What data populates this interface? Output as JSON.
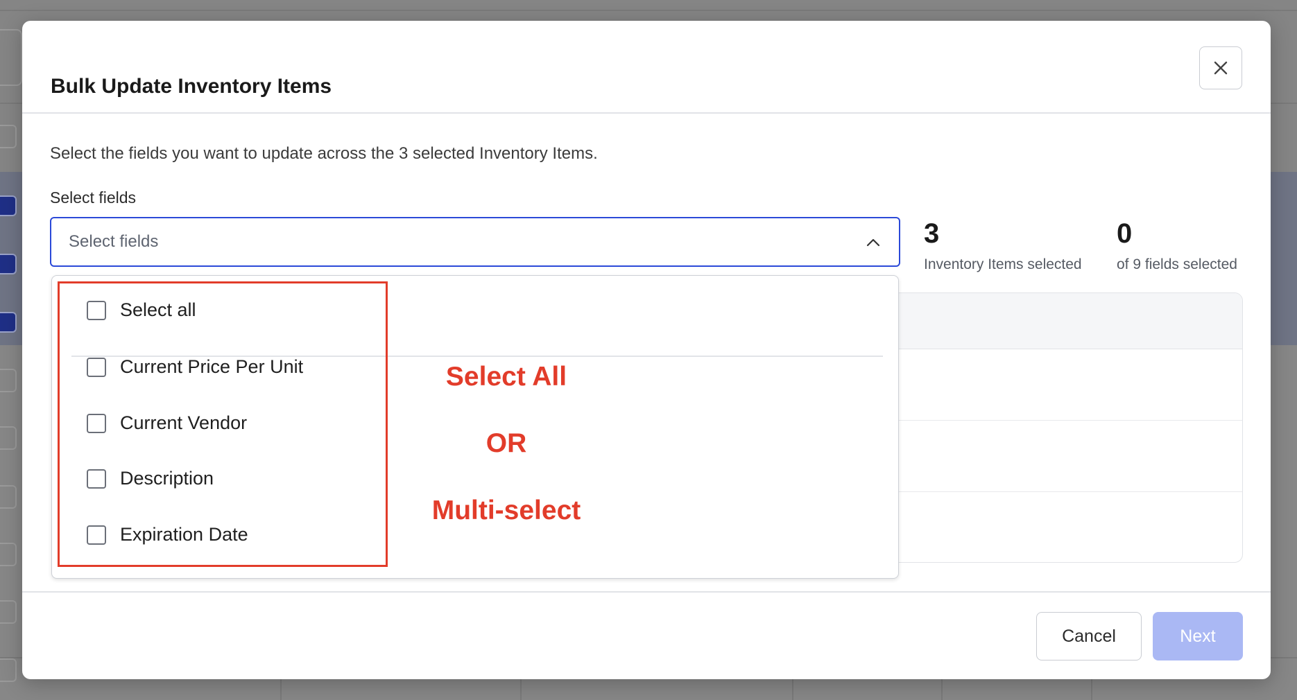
{
  "modal": {
    "title": "Bulk Update Inventory Items",
    "description": "Select the fields you want to update across the 3 selected Inventory Items.",
    "select_label": "Select fields",
    "select_placeholder": "Select fields"
  },
  "stats": {
    "items_count": "3",
    "items_label": "Inventory Items selected",
    "fields_count": "0",
    "fields_label": "of 9 fields selected"
  },
  "dropdown": {
    "options": [
      {
        "label": "Select all",
        "checked": false
      },
      {
        "label": "Current Price Per Unit",
        "checked": false
      },
      {
        "label": "Current Vendor",
        "checked": false
      },
      {
        "label": "Description",
        "checked": false
      },
      {
        "label": "Expiration Date",
        "checked": false
      }
    ]
  },
  "annotations": {
    "line1": "Select All",
    "line2": "OR",
    "line3": "Multi-select"
  },
  "footer": {
    "cancel_label": "Cancel",
    "next_label": "Next"
  },
  "colors": {
    "primary": "#2b49d8",
    "next_disabled": "#aab8f4",
    "annotation": "#e23c2a"
  },
  "icons": {
    "close": "close-icon",
    "chevron": "chevron-up-icon"
  }
}
